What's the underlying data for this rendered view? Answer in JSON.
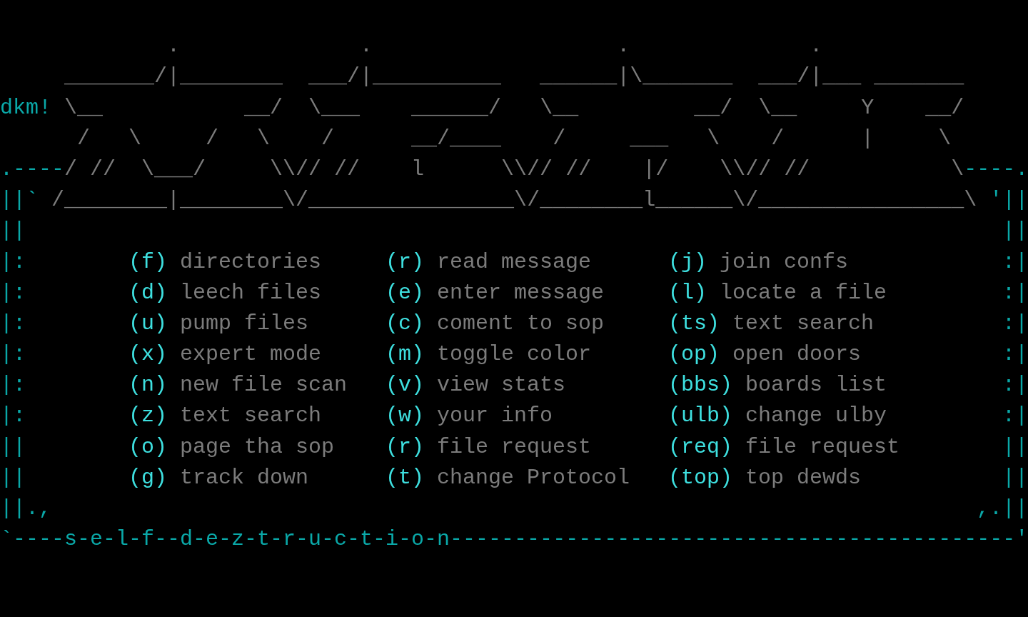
{
  "header_art": [
    {
      "segments": [
        {
          "kind": "art",
          "text": "             .              .                   .              ."
        }
      ]
    },
    {
      "segments": [
        {
          "kind": "art",
          "text": "     _______/|________  ___/|__________   ______|\\_______  ___/|___ _______"
        }
      ]
    },
    {
      "segments": [
        {
          "kind": "tag",
          "text": "dkm!"
        },
        {
          "kind": "art",
          "text": " \\__           __/  \\___    ______/   \\__         __/  \\__     Y    __/"
        }
      ]
    },
    {
      "segments": [
        {
          "kind": "art",
          "text": "      /   \\     /   \\    /      __/____    /     ___   \\    /      |     \\"
        }
      ]
    },
    {
      "segments": [
        {
          "kind": "frame",
          "text": ".----"
        },
        {
          "kind": "art",
          "text": "/ //  \\___/     \\\\// //    l      \\\\// //    |/    \\\\// //           \\"
        },
        {
          "kind": "frame",
          "text": "----."
        }
      ]
    },
    {
      "segments": [
        {
          "kind": "frame",
          "text": "||`"
        },
        {
          "kind": "art",
          "text": " /________|________\\/________________\\/________l______\\/________________\\ "
        },
        {
          "kind": "frame",
          "text": "'||"
        }
      ]
    }
  ],
  "panel_rows": [
    {
      "left": "||",
      "right": "||"
    },
    {
      "left": "|:",
      "right": ":|",
      "options": [
        {
          "key": "(f)",
          "label": "directories"
        },
        {
          "key": "(r)",
          "label": "read message"
        },
        {
          "key": "(j)",
          "label": "join confs"
        }
      ]
    },
    {
      "left": "|:",
      "right": ":|",
      "options": [
        {
          "key": "(d)",
          "label": "leech files"
        },
        {
          "key": "(e)",
          "label": "enter message"
        },
        {
          "key": "(l)",
          "label": "locate a file"
        }
      ]
    },
    {
      "left": "|:",
      "right": ":|",
      "options": [
        {
          "key": "(u)",
          "label": "pump files"
        },
        {
          "key": "(c)",
          "label": "coment to sop"
        },
        {
          "key": "(ts)",
          "label": "text search"
        }
      ]
    },
    {
      "left": "|:",
      "right": ":|",
      "options": [
        {
          "key": "(x)",
          "label": "expert mode"
        },
        {
          "key": "(m)",
          "label": "toggle color"
        },
        {
          "key": "(op)",
          "label": "open doors"
        }
      ]
    },
    {
      "left": "|:",
      "right": ":|",
      "options": [
        {
          "key": "(n)",
          "label": "new file scan"
        },
        {
          "key": "(v)",
          "label": "view stats"
        },
        {
          "key": "(bbs)",
          "label": "boards list"
        }
      ]
    },
    {
      "left": "|:",
      "right": ":|",
      "options": [
        {
          "key": "(z)",
          "label": "text search"
        },
        {
          "key": "(w)",
          "label": "your info"
        },
        {
          "key": "(ulb)",
          "label": "change ulby"
        }
      ]
    },
    {
      "left": "||",
      "right": "||",
      "options": [
        {
          "key": "(o)",
          "label": "page tha sop"
        },
        {
          "key": "(r)",
          "label": "file request"
        },
        {
          "key": "(req)",
          "label": "file request"
        }
      ]
    },
    {
      "left": "||",
      "right": "||",
      "options": [
        {
          "key": "(g)",
          "label": "track down"
        },
        {
          "key": "(t)",
          "label": "change Protocol"
        },
        {
          "key": "(top)",
          "label": "top dewds"
        }
      ]
    },
    {
      "left": "||.,",
      "right": ",.||"
    }
  ],
  "footer_border": "`----s-e-l-f--d-e-z-t-r-u-c-t-i-o-n--------------------------------------------'"
}
